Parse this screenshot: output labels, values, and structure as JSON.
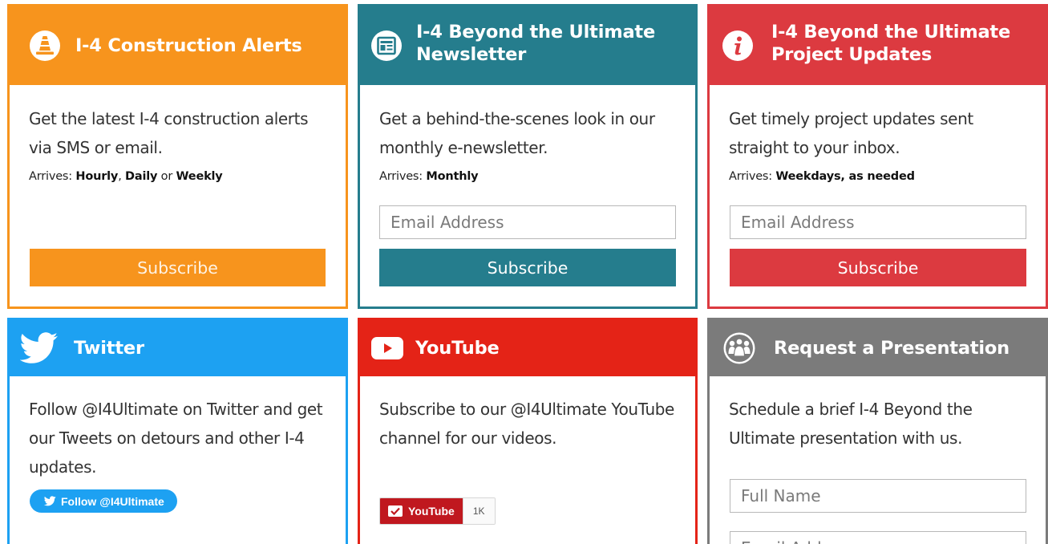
{
  "colors": {
    "orange": "#f7941d",
    "teal": "#257d8d",
    "red": "#dc3a40",
    "twitter": "#1da1f2",
    "youtube": "#e42317",
    "gray": "#7b7b7b"
  },
  "cards": {
    "alerts": {
      "icon": "traffic-cone-icon",
      "title": "I-4 Construction Alerts",
      "description": "Get the latest I-4 construction alerts via SMS or email.",
      "arrives_label": "Arrives:",
      "freq_1": "Hourly",
      "sep_1": ",",
      "freq_2": "Daily",
      "sep_2": "or",
      "freq_3": "Weekly",
      "button": "Subscribe"
    },
    "newsletter": {
      "icon": "newsletter-icon",
      "title_line1": "I-4 Beyond the Ultimate",
      "title_line2": "Newsletter",
      "description": "Get a behind-the-scenes look in our monthly e-newsletter.",
      "arrives_label": "Arrives:",
      "arrives_value": "Monthly",
      "email_placeholder": "Email Address",
      "button": "Subscribe"
    },
    "updates": {
      "icon": "info-icon",
      "title_line1": "I-4 Beyond the Ultimate",
      "title_line2": "Project Updates",
      "description": "Get timely project updates sent straight to your inbox.",
      "arrives_label": "Arrives:",
      "arrives_value": "Weekdays, as needed",
      "email_placeholder": "Email Address",
      "button": "Subscribe"
    },
    "twitter": {
      "icon": "twitter-bird-icon",
      "title": "Twitter",
      "description": "Follow @I4Ultimate on Twitter and get our Tweets on detours and other I-4 updates.",
      "follow_button": "Follow @I4Ultimate"
    },
    "youtube": {
      "icon": "youtube-play-icon",
      "title": "YouTube",
      "description": "Subscribe to our @I4Ultimate YouTube channel for our videos.",
      "subscribe_label": "YouTube",
      "subscriber_count": "1K"
    },
    "presentation": {
      "icon": "group-people-icon",
      "title": "Request a Presentation",
      "description": "Schedule a brief I-4 Beyond the Ultimate presentation with us.",
      "name_placeholder": "Full Name",
      "email_placeholder": "Email Address"
    }
  }
}
